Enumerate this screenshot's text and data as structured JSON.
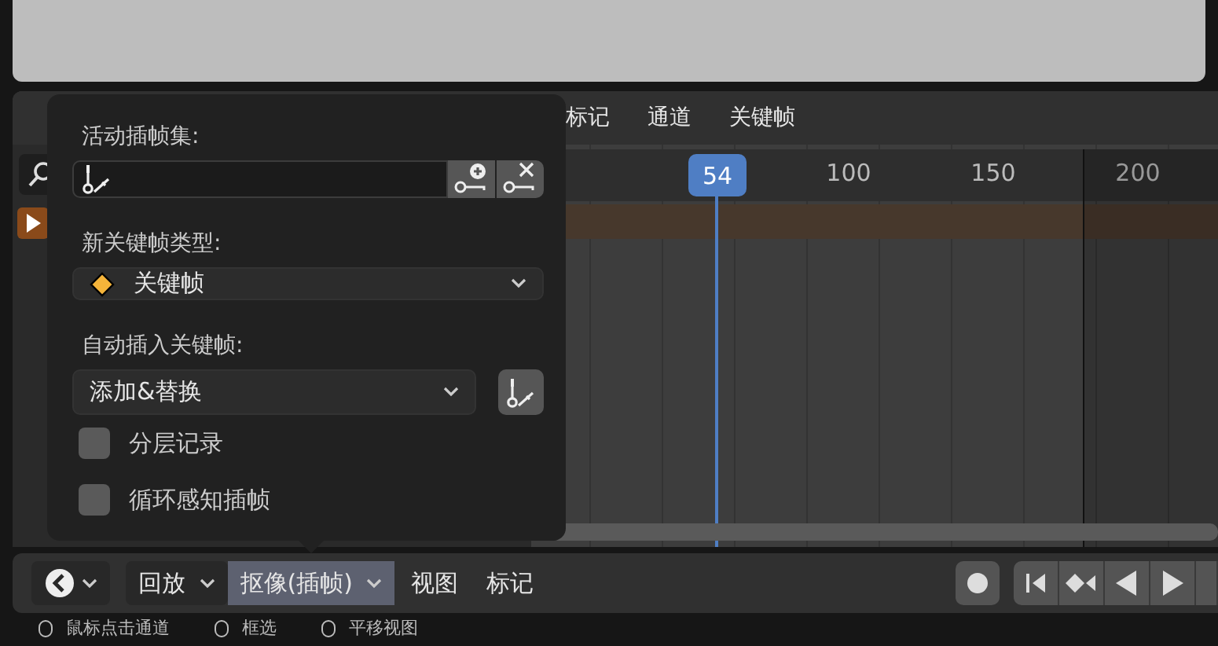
{
  "header_menus": [
    {
      "label": "标记"
    },
    {
      "label": "通道"
    },
    {
      "label": "关键帧"
    }
  ],
  "timeline": {
    "current_frame": "54",
    "ruler_labels": [
      "100",
      "150",
      "200"
    ]
  },
  "popover": {
    "active_keying_set_label": "活动插帧集:",
    "new_keyframe_type_label": "新关键帧类型:",
    "keyframe_type": "关键帧",
    "auto_keying_label": "自动插入关键帧:",
    "auto_keying_mode": "添加&替换",
    "checkboxes": [
      {
        "label": "分层记录",
        "checked": false
      },
      {
        "label": "循环感知插帧",
        "checked": false
      }
    ]
  },
  "footer": {
    "menus": [
      {
        "label": "回放",
        "selected": false,
        "kind": "dropdown"
      },
      {
        "label": "抠像(插帧)",
        "selected": true,
        "kind": "dropdown"
      },
      {
        "label": "视图",
        "selected": false,
        "kind": "menu"
      },
      {
        "label": "标记",
        "selected": false,
        "kind": "menu"
      }
    ]
  },
  "status_bar": [
    {
      "text": "鼠标点击通道"
    },
    {
      "text": "框选"
    },
    {
      "text": "平移视图"
    }
  ]
}
